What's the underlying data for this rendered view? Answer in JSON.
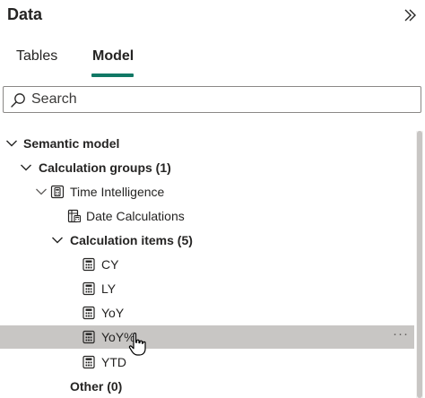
{
  "pane": {
    "title": "Data",
    "collapse_icon": "double-chevron-right-icon"
  },
  "tabs": [
    {
      "label": "Tables",
      "selected": false
    },
    {
      "label": "Model",
      "selected": true
    }
  ],
  "accent_color": "#117865",
  "search": {
    "placeholder": "Search",
    "value": "",
    "icon": "search-icon"
  },
  "tree": {
    "semantic_model": {
      "label": "Semantic model",
      "expanded": true
    },
    "calculation_groups": {
      "label": "Calculation groups (1)",
      "expanded": true
    },
    "time_intelligence": {
      "label": "Time Intelligence",
      "expanded": true,
      "icon": "calculation-group-icon"
    },
    "date_calculations": {
      "label": "Date Calculations",
      "icon": "calculation-column-icon"
    },
    "calculation_items": {
      "label": "Calculation items (5)",
      "expanded": true
    },
    "items": [
      {
        "label": "CY",
        "icon": "calculator-icon"
      },
      {
        "label": "LY",
        "icon": "calculator-icon"
      },
      {
        "label": "YoY",
        "icon": "calculator-icon"
      },
      {
        "label": "YoY%",
        "icon": "calculator-icon",
        "hovered": true,
        "more_label": "···"
      },
      {
        "label": "YTD",
        "icon": "calculator-icon"
      }
    ],
    "other": {
      "label": "Other (0)"
    }
  },
  "hover_color": "#c8c6c4"
}
